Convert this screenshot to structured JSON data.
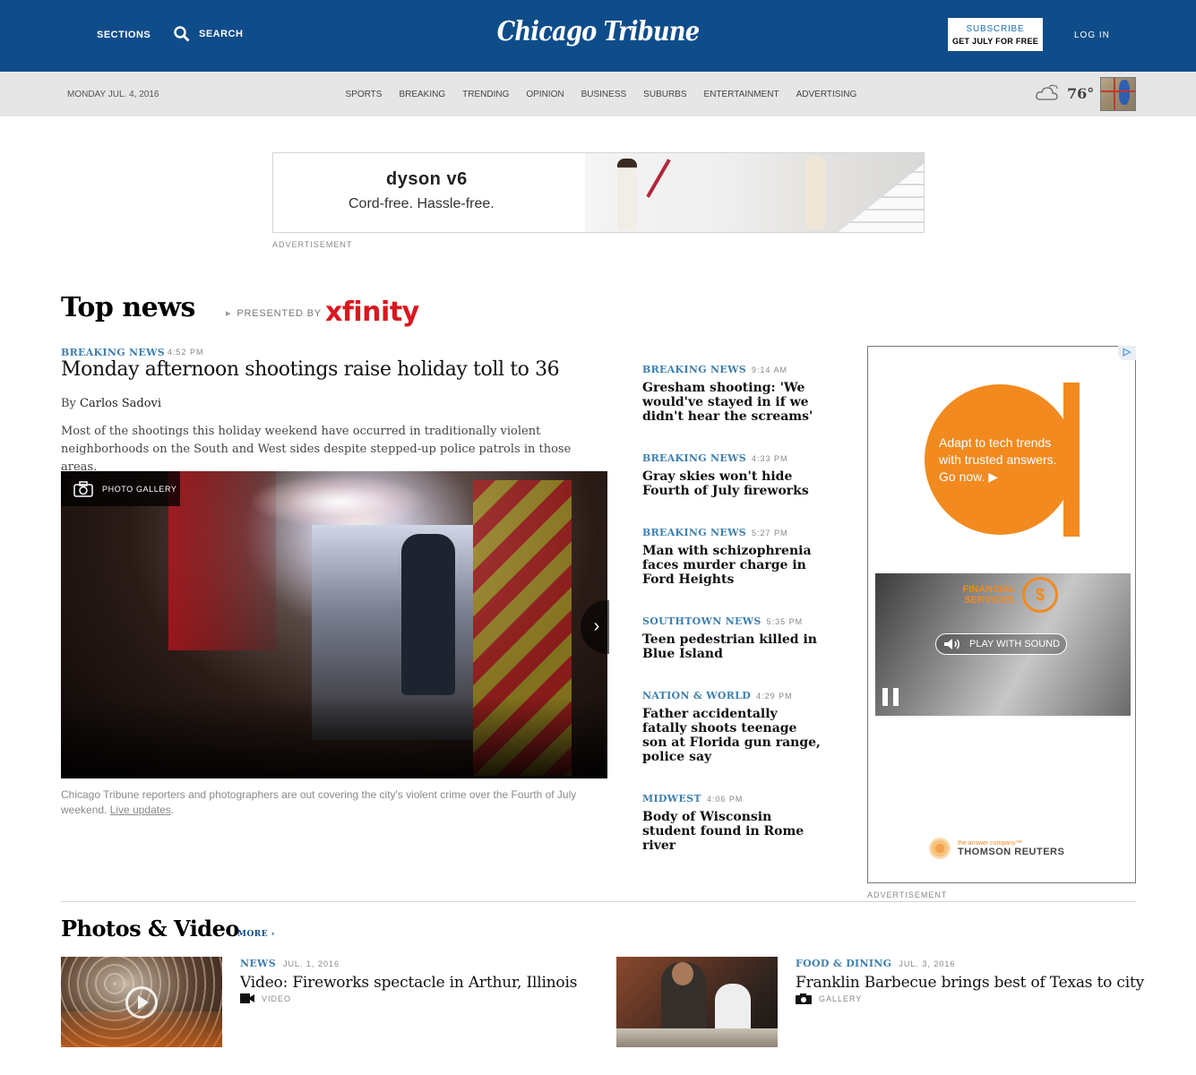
{
  "header": {
    "sections_label": "SECTIONS",
    "search_label": "SEARCH",
    "logo_text": "Chicago Tribune",
    "subscribe_line1": "SUBSCRIBE",
    "subscribe_line2": "GET JULY FOR FREE",
    "login_label": "LOG IN"
  },
  "navbar": {
    "date": "MONDAY JUL. 4, 2016",
    "links": [
      "SPORTS",
      "BREAKING",
      "TRENDING",
      "OPINION",
      "BUSINESS",
      "SUBURBS",
      "ENTERTAINMENT",
      "ADVERTISING"
    ],
    "temperature": "76°",
    "weather_icon": "cloudy-icon"
  },
  "top_ad": {
    "brand": "dyson v6",
    "tagline": "Cord-free.  Hassle-free.",
    "label": "ADVERTISEMENT"
  },
  "top_news": {
    "heading": "Top news",
    "presented_by": "PRESENTED BY",
    "sponsor": "xfinity",
    "lead": {
      "kicker": "BREAKING NEWS",
      "time": "4:52 PM",
      "headline": "Monday afternoon shootings raise holiday toll to 36",
      "by": "By",
      "author": "Carlos Sadovi",
      "summary": "Most of the shootings this holiday weekend have occurred in traditionally violent neighborhoods on the South and West sides despite stepped-up police patrols in those areas.",
      "gallery_label": "PHOTO GALLERY",
      "caption": "Chicago Tribune reporters and photographers are out covering the city's violent crime over the Fourth of July weekend.",
      "caption_link": "Live updates",
      "caption_end": "."
    },
    "side_stories": [
      {
        "kicker": "BREAKING NEWS",
        "time": "9:14 AM",
        "headline": "Gresham shooting: 'We would've stayed in if we didn't hear the screams'"
      },
      {
        "kicker": "BREAKING NEWS",
        "time": "4:33 PM",
        "headline": "Gray skies won't hide Fourth of July fireworks"
      },
      {
        "kicker": "BREAKING NEWS",
        "time": "5:27 PM",
        "headline": "Man with schizophrenia faces murder charge in Ford Heights"
      },
      {
        "kicker": "SOUTHTOWN NEWS",
        "time": "5:35 PM",
        "headline": "Teen pedestrian killed in Blue Island"
      },
      {
        "kicker": "NATION & WORLD",
        "time": "4:29 PM",
        "headline": "Father accidentally fatally shoots teenage son at Florida gun range, police say"
      },
      {
        "kicker": "MIDWEST",
        "time": "4:06 PM",
        "headline": "Body of Wisconsin student found in Rome river"
      }
    ]
  },
  "right_ad": {
    "text": "Adapt to tech trends with trusted answers. Go now. ▶",
    "financial": "FINANCIAL SERVICES",
    "play_with_sound": "PLAY WITH SOUND",
    "small": "the answer company™",
    "brand": "THOMSON REUTERS",
    "label": "ADVERTISEMENT"
  },
  "photos_video": {
    "heading": "Photos & Video",
    "more": "MORE ›",
    "items": [
      {
        "kicker": "NEWS",
        "date": "JUL. 1, 2016",
        "headline": "Video: Fireworks spectacle in Arthur, Illinois",
        "type": "VIDEO"
      },
      {
        "kicker": "FOOD & DINING",
        "date": "JUL. 3, 2016",
        "headline": "Franklin Barbecue brings best of Texas to city",
        "type": "GALLERY"
      }
    ]
  }
}
